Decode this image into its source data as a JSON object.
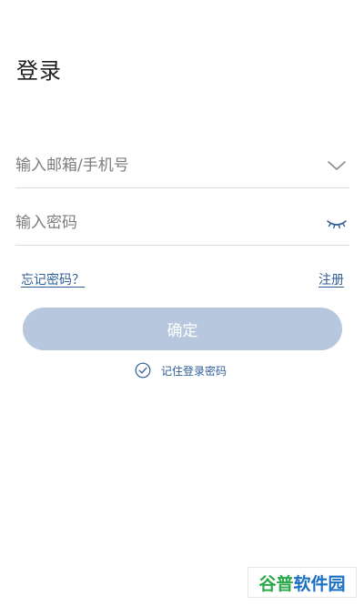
{
  "page": {
    "title": "登录"
  },
  "form": {
    "account": {
      "placeholder": "输入邮箱/手机号",
      "value": "",
      "icon": "chevron-down-icon"
    },
    "password": {
      "placeholder": "输入密码",
      "value": "",
      "icon": "eye-closed-icon"
    },
    "forgot_label": "忘记密码？",
    "register_label": "注册",
    "confirm_label": "确定",
    "remember_label": "记住登录密码"
  },
  "watermark": {
    "part1": "谷普",
    "part2": "软件园"
  },
  "colors": {
    "accent": "#2f5e96",
    "button_bg": "#b6c7de",
    "divider": "#dcdcdc"
  }
}
